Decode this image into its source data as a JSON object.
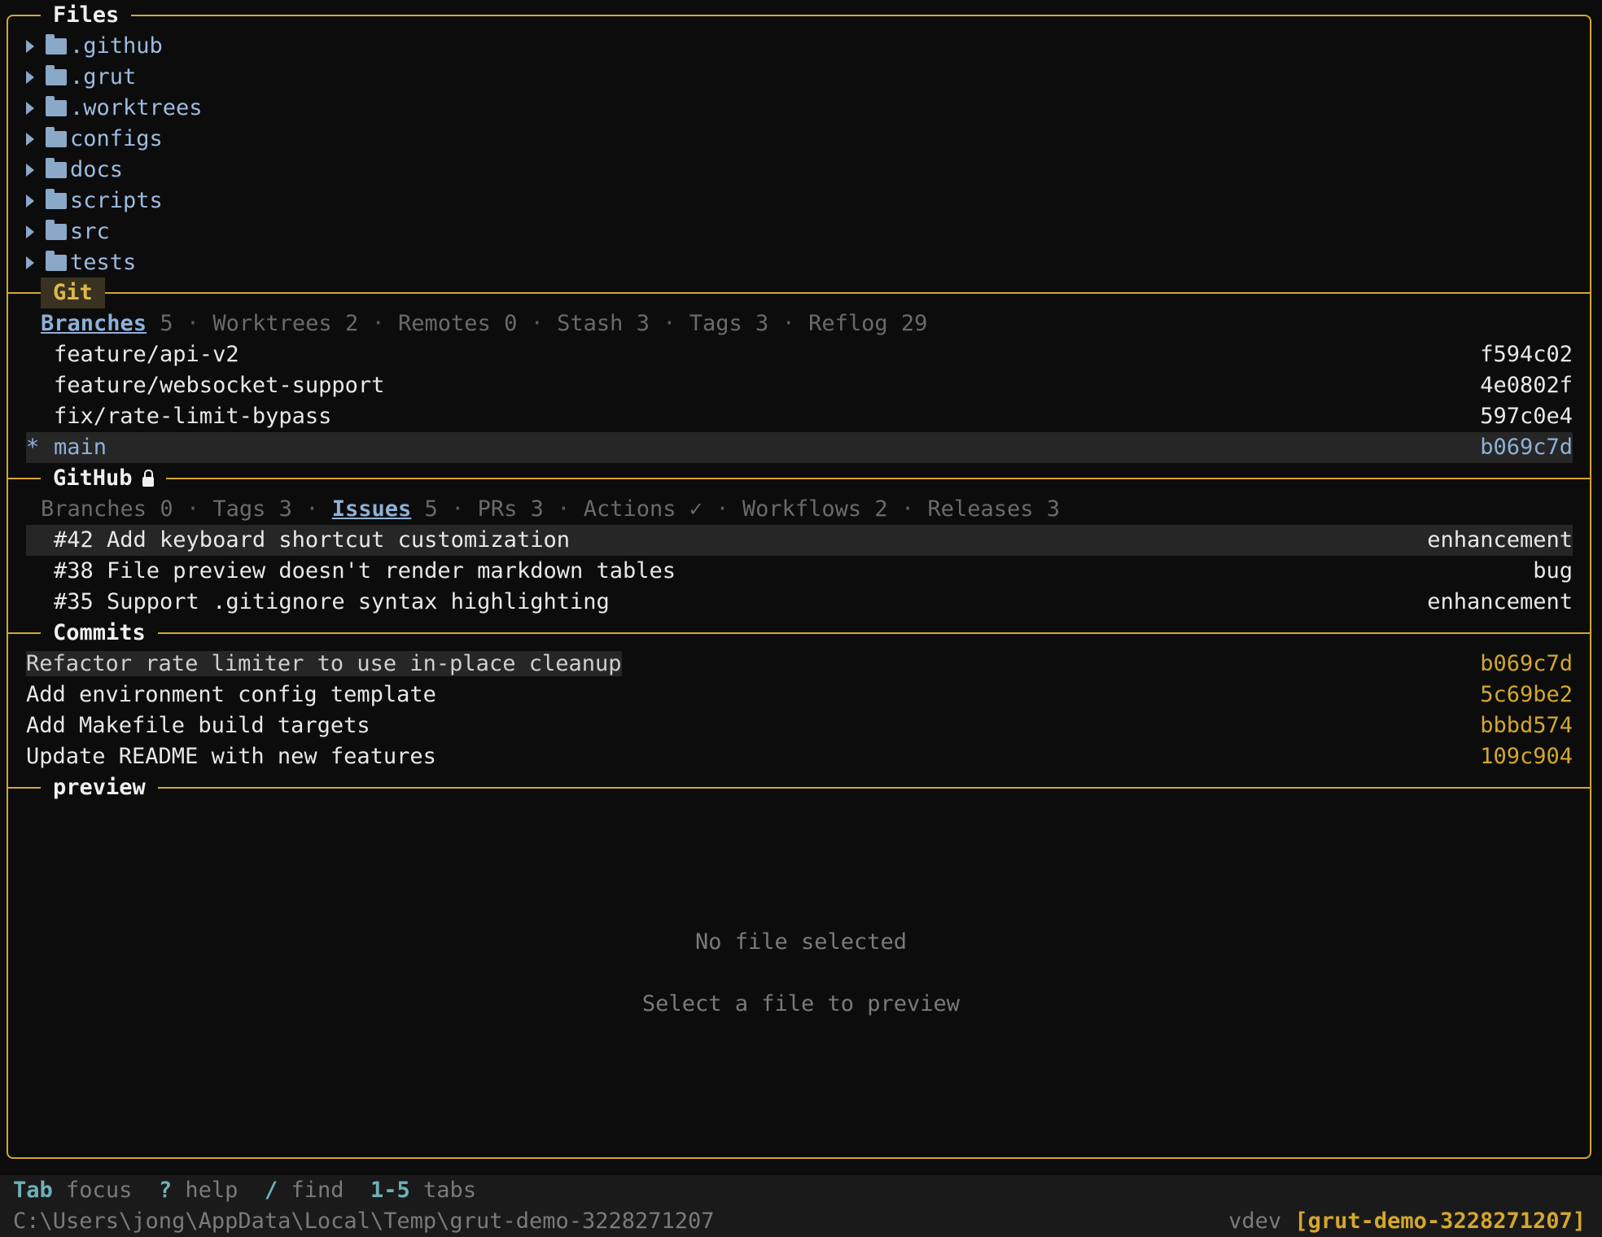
{
  "sections": {
    "files": "Files",
    "git": "Git",
    "github": "GitHub",
    "commits": "Commits",
    "preview": "preview"
  },
  "files": [
    ".github",
    ".grut",
    ".worktrees",
    "configs",
    "docs",
    "scripts",
    "src",
    "tests"
  ],
  "git_tabs": [
    {
      "label": "Branches",
      "count": "5",
      "active": true
    },
    {
      "label": "Worktrees",
      "count": "2"
    },
    {
      "label": "Remotes",
      "count": "0"
    },
    {
      "label": "Stash",
      "count": "3"
    },
    {
      "label": "Tags",
      "count": "3"
    },
    {
      "label": "Reflog",
      "count": "29"
    }
  ],
  "branches": [
    {
      "name": "feature/api-v2",
      "hash": "f594c02",
      "current": false
    },
    {
      "name": "feature/websocket-support",
      "hash": "4e0802f",
      "current": false
    },
    {
      "name": "fix/rate-limit-bypass",
      "hash": "597c0e4",
      "current": false
    },
    {
      "name": "main",
      "hash": "b069c7d",
      "current": true,
      "marker": "*"
    }
  ],
  "github_tabs": [
    {
      "label": "Branches",
      "count": "0"
    },
    {
      "label": "Tags",
      "count": "3"
    },
    {
      "label": "Issues",
      "count": "5",
      "active": true
    },
    {
      "label": "PRs",
      "count": "3"
    },
    {
      "label": "Actions",
      "count": "✓"
    },
    {
      "label": "Workflows",
      "count": "2"
    },
    {
      "label": "Releases",
      "count": "3"
    }
  ],
  "issues": [
    {
      "title": "#42 Add keyboard shortcut customization",
      "label": "enhancement"
    },
    {
      "title": "#38 File preview doesn't render markdown tables",
      "label": "bug"
    },
    {
      "title": "#35 Support .gitignore syntax highlighting",
      "label": "enhancement"
    }
  ],
  "commits": [
    {
      "message": "Refactor rate limiter to use in-place cleanup",
      "hash": "b069c7d"
    },
    {
      "message": "Add environment config template",
      "hash": "5c69be2"
    },
    {
      "message": "Add Makefile build targets",
      "hash": "bbbd574"
    },
    {
      "message": "Update README with new features",
      "hash": "109c904"
    }
  ],
  "preview": {
    "empty_title": "No file selected",
    "empty_hint": "Select a file to preview"
  },
  "status": {
    "keys": [
      {
        "key": "Tab",
        "desc": "focus"
      },
      {
        "key": "?",
        "desc": "help"
      },
      {
        "key": "/",
        "desc": "find"
      },
      {
        "key": "1-5",
        "desc": "tabs"
      }
    ],
    "path": "C:\\Users\\jong\\AppData\\Local\\Temp\\grut-demo-3228271207",
    "version": "vdev",
    "repo": "[grut-demo-3228271207]"
  },
  "colors": {
    "accent": "#d4a72c",
    "folder": "#8aa8c8",
    "link": "#8fb0d8",
    "key": "#6fb0b8"
  }
}
